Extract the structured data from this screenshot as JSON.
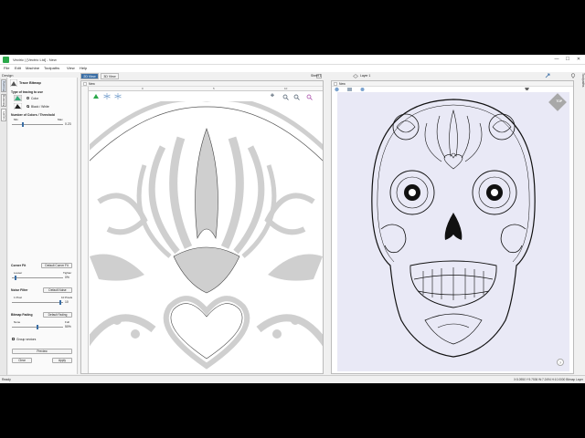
{
  "window": {
    "title": "Vectric | [Vectric Ltd] - New",
    "minimize": "—",
    "maximize": "☐",
    "close": "✕"
  },
  "menu": [
    "File",
    "Edit",
    "Machine",
    "Toolpaths",
    "View",
    "Help"
  ],
  "design_label": "Design",
  "left_tabs": [
    "Drawing",
    "Modeling",
    "Layers"
  ],
  "trace": {
    "title": "Trace Bitmap",
    "type_label": "Type of tracing to use",
    "opt_color": "Color",
    "opt_bw": "Black / White",
    "colors_label": "Number of Colors / Threshold",
    "min": "Min",
    "max": "Max",
    "threshold_value": "0.23",
    "threshold_level": 0.22,
    "corner_fit_label": "Corner Fit",
    "corner_default": "Default Corner Fit",
    "looser": "Looser",
    "tighter": "Tighter",
    "corner_value": "0%",
    "corner_level": 0.08,
    "noise_label": "Noise Filter",
    "noise_default": "Default Noise",
    "noise_min": "1 Pixel",
    "noise_max": "10 Pixels",
    "noise_value": "10",
    "noise_level": 0.95,
    "fading_label": "Bitmap Fading",
    "fading_default": "Default Fading",
    "none": "None",
    "full": "Full",
    "fading_value": "50%",
    "fading_level": 0.5,
    "group_label": "Group vectors",
    "preview": "Preview",
    "clear": "Clear",
    "apply": "Apply"
  },
  "views": {
    "tab_2d": "2D View",
    "tab_3d": "3D View",
    "left_doc": "New",
    "right_doc": "New",
    "sheet": "Sheet 1",
    "layer": "Layer 1",
    "top_label": "TOP",
    "help": "?"
  },
  "ruler_numbers": [
    "0",
    "5",
    "10"
  ],
  "status": {
    "left": "Ready",
    "right": "X:5.0950 Y:9.7536   W:7.2494 H:10.0000 Bitmap Layer"
  },
  "right_tab": "Toolpaths",
  "icons": {
    "zoom": "zoom-icon",
    "pan": "pan-icon",
    "select": "select-icon"
  },
  "colors": {
    "accent": "#3a6ea5",
    "bitmap_gray": "#cfcfcf",
    "canvas_tint": "#e9e9f6",
    "app_green": "#2aa84a"
  }
}
